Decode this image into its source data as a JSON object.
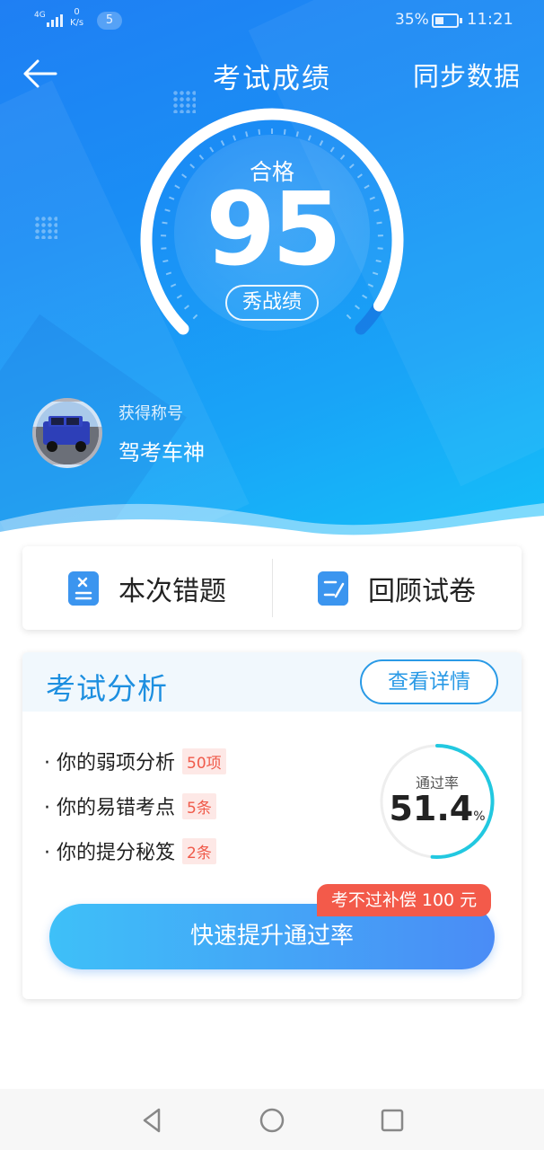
{
  "status_bar": {
    "network": "4G",
    "speed_value": "0",
    "speed_unit": "K/s",
    "notification_count": "5",
    "battery": "35%",
    "time": "11:21"
  },
  "header": {
    "title": "考试成绩",
    "sync_label": "同步数据"
  },
  "score": {
    "grade": "合格",
    "value": "95",
    "show_label": "秀战绩",
    "max": 100
  },
  "user": {
    "label": "获得称号",
    "title": "驾考车神"
  },
  "actions": {
    "wrong_label": "本次错题",
    "review_label": "回顾试卷"
  },
  "analysis": {
    "title": "考试分析",
    "detail_label": "查看详情",
    "items": [
      {
        "text": "· 你的弱项分析",
        "tag": "50项"
      },
      {
        "text": "· 你的易错考点",
        "tag": "5条"
      },
      {
        "text": "· 你的提分秘笈",
        "tag": "2条"
      }
    ],
    "pass_rate_label": "通过率",
    "pass_rate_value": "51.4",
    "pass_rate_unit": "%",
    "pass_rate_fraction": 0.514,
    "boost_label": "快速提升通过率",
    "promo_label": "考不过补偿 100 元"
  },
  "colors": {
    "accent": "#1d8fe0",
    "tag_red": "#f05a4a",
    "ring_cyan": "#22c8e0"
  },
  "icons": {
    "back": "arrow-left-icon",
    "wrong": "wrong-questions-icon",
    "review": "review-paper-icon"
  }
}
